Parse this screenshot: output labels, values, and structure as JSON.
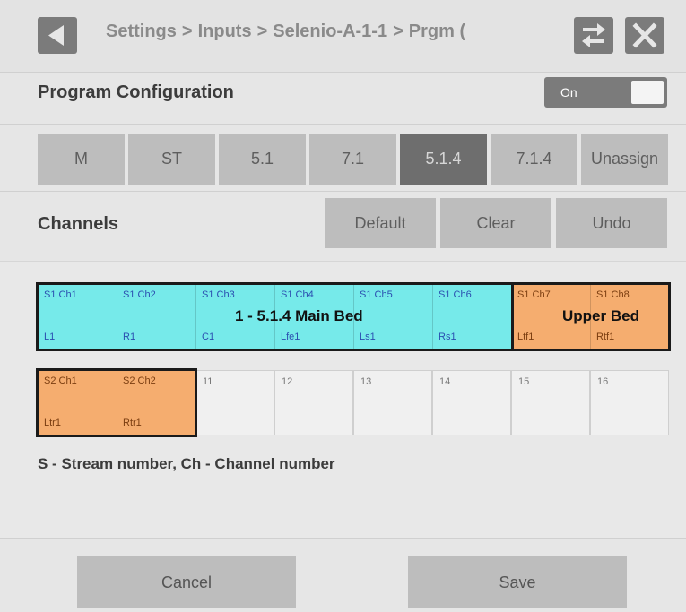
{
  "header": {
    "breadcrumb": [
      "Settings",
      "Inputs",
      "Selenio-A-1-1",
      "Prgm ("
    ],
    "separator": ">",
    "back_icon": "back-arrow-icon",
    "swap_icon": "swap-arrows-icon",
    "close_icon": "close-icon"
  },
  "program_config": {
    "title": "Program Configuration",
    "toggle_label": "On",
    "toggle_on": true
  },
  "formats": {
    "buttons": [
      "M",
      "ST",
      "5.1",
      "7.1",
      "5.1.4",
      "7.1.4",
      "Unassign"
    ],
    "selected": "5.1.4"
  },
  "channels": {
    "title": "Channels",
    "actions": [
      "Default",
      "Clear",
      "Undo"
    ]
  },
  "grid": {
    "row1": [
      {
        "top": "S1 Ch1",
        "bottom": "L1"
      },
      {
        "top": "S1 Ch2",
        "bottom": "R1"
      },
      {
        "top": "S1 Ch3",
        "bottom": "C1"
      },
      {
        "top": "S1 Ch4",
        "bottom": "Lfe1"
      },
      {
        "top": "S1 Ch5",
        "bottom": "Ls1"
      },
      {
        "top": "S1 Ch6",
        "bottom": "Rs1"
      },
      {
        "top": "S1 Ch7",
        "bottom": "Ltf1"
      },
      {
        "top": "S1 Ch8",
        "bottom": "Rtf1"
      }
    ],
    "row2": [
      {
        "top": "S2 Ch1",
        "bottom": "Ltr1"
      },
      {
        "top": "S2 Ch2",
        "bottom": "Rtr1"
      },
      {
        "top": "11",
        "bottom": ""
      },
      {
        "top": "12",
        "bottom": ""
      },
      {
        "top": "13",
        "bottom": ""
      },
      {
        "top": "14",
        "bottom": ""
      },
      {
        "top": "15",
        "bottom": ""
      },
      {
        "top": "16",
        "bottom": ""
      }
    ],
    "main_bed_label": "1 - 5.1.4 Main Bed",
    "upper_bed_label": "Upper Bed",
    "colors": {
      "main_bed": "#76eaea",
      "upper_bed": "#f5ad6f",
      "empty": "#f0f0f0"
    }
  },
  "legend": "S - Stream number, Ch - Channel number",
  "footer": {
    "cancel": "Cancel",
    "save": "Save"
  }
}
